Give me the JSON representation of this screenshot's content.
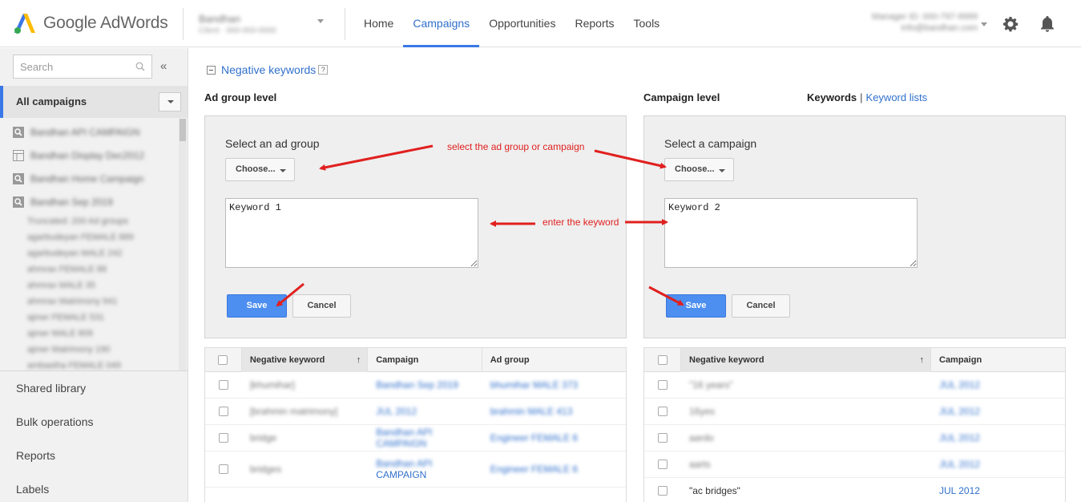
{
  "header": {
    "logo_text": "Google AdWords",
    "account_name": "Bandhan",
    "account_sub": "Client · 000-000-0000",
    "nav": [
      "Home",
      "Campaigns",
      "Opportunities",
      "Reports",
      "Tools"
    ],
    "active_nav": "Campaigns",
    "user_line1": "Manager ID: 000-797-9999",
    "user_line2": "info@bandhan.com",
    "icons": [
      "settings-gear-icon",
      "notification-bell-icon"
    ]
  },
  "sidebar": {
    "search_placeholder": "Search",
    "collapse_glyph": "«",
    "all_campaigns": "All campaigns",
    "campaigns": [
      {
        "name": "Bandhan API CAMPAIGN",
        "icon": "search"
      },
      {
        "name": "Bandhan Display Dec2012",
        "icon": "display"
      },
      {
        "name": "Bandhan Home Campaign",
        "icon": "search"
      },
      {
        "name": "Bandhan Sep 2019",
        "icon": "search"
      }
    ],
    "sub_items": [
      "Truncated: 200 Ad groups",
      "agarbudeyan FEMALE 889",
      "agarbudeyan MALE 242",
      "ahmrax FEMALE 88",
      "ahmrax MALE 35",
      "ahmrax Matrimony 941",
      "ajmer FEMALE 531",
      "ajmer MALE 809",
      "ajmer Matrimony 190",
      "ambastha FEMALE 049"
    ],
    "links": [
      "Shared library",
      "Bulk operations",
      "Reports",
      "Labels"
    ]
  },
  "main": {
    "section_title": "Negative keywords",
    "help_glyph": "?",
    "ad_group_level": {
      "label": "Ad group level",
      "panel_title": "Select an ad group",
      "choose_label": "Choose...",
      "keyword_value": "Keyword 1",
      "save_label": "Save",
      "cancel_label": "Cancel"
    },
    "campaign_level": {
      "label": "Campaign level",
      "toggle_keywords": "Keywords",
      "toggle_sep": "|",
      "toggle_lists": "Keyword lists",
      "panel_title": "Select a campaign",
      "choose_label": "Choose...",
      "keyword_value": "Keyword 2",
      "save_label": "Save",
      "cancel_label": "Cancel"
    },
    "annotations": {
      "select": "select the ad group or campaign",
      "enter": "enter the keyword"
    },
    "left_table": {
      "headers": [
        "Negative keyword",
        "Campaign",
        "Ad group"
      ],
      "sort_glyph": "↑",
      "rows": [
        {
          "kw": "[khumihar]",
          "campaign": "Bandhan Sep 2019",
          "campaign2": "",
          "adgroup": "bhumihar MALE 373",
          "adgroup2": ""
        },
        {
          "kw": "[brahmin matrimony]",
          "campaign": "JUL 2012",
          "campaign2": "",
          "adgroup": "brahmin MALE 413",
          "adgroup2": ""
        },
        {
          "kw": "bridge",
          "campaign": "Bandhan API",
          "campaign2": "CAMPAIGN",
          "adgroup": "Engineer FEMALE 6",
          "adgroup2": ""
        },
        {
          "kw": "bridges",
          "campaign": "Bandhan API",
          "campaign2": "CAMPAIGN",
          "adgroup": "Engineer FEMALE 6",
          "adgroup2": ""
        }
      ]
    },
    "right_table": {
      "headers": [
        "Negative keyword",
        "Campaign"
      ],
      "sort_glyph": "↑",
      "rows": [
        {
          "kw": "\"16 years\"",
          "campaign": "JUL 2012"
        },
        {
          "kw": "16yes",
          "campaign": "JUL 2012"
        },
        {
          "kw": "aardo",
          "campaign": "JUL 2012"
        },
        {
          "kw": "aarts",
          "campaign": "JUL 2012"
        },
        {
          "kw": "\"ac bridges\"",
          "campaign": "JUL 2012"
        }
      ]
    }
  },
  "colors": {
    "accent": "#3b78e7",
    "link": "#3070cc",
    "annotation": "#e0201f",
    "save_button": "#4d8ff0"
  }
}
